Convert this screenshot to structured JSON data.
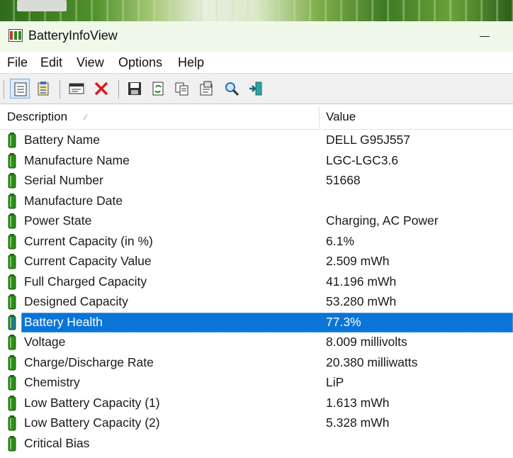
{
  "window": {
    "title": "BatteryInfoView"
  },
  "menu": {
    "items": [
      "File",
      "Edit",
      "View",
      "Options",
      "Help"
    ]
  },
  "toolbar": {
    "buttons": [
      "view-list-icon",
      "view-html-icon",
      "properties-window-icon",
      "delete-icon",
      "save-icon",
      "refresh-icon",
      "copy-icon",
      "properties-icon",
      "find-icon",
      "exit-icon"
    ]
  },
  "table": {
    "columns": [
      "Description",
      "Value"
    ],
    "rows": [
      {
        "desc": "Battery Name",
        "value": "DELL G95J557"
      },
      {
        "desc": "Manufacture Name",
        "value": "LGC-LGC3.6"
      },
      {
        "desc": "Serial Number",
        "value": "51668"
      },
      {
        "desc": "Manufacture Date",
        "value": ""
      },
      {
        "desc": "Power State",
        "value": "Charging, AC Power"
      },
      {
        "desc": "Current Capacity (in %)",
        "value": "6.1%"
      },
      {
        "desc": "Current Capacity Value",
        "value": "2.509 mWh"
      },
      {
        "desc": "Full Charged Capacity",
        "value": "41.196 mWh"
      },
      {
        "desc": "Designed Capacity",
        "value": "53.280 mWh"
      },
      {
        "desc": "Battery Health",
        "value": "77.3%"
      },
      {
        "desc": "Voltage",
        "value": "8.009 millivolts"
      },
      {
        "desc": "Charge/Discharge Rate",
        "value": "20.380 milliwatts"
      },
      {
        "desc": "Chemistry",
        "value": "LiP"
      },
      {
        "desc": "Low Battery Capacity (1)",
        "value": "1.613 mWh"
      },
      {
        "desc": "Low Battery Capacity (2)",
        "value": "5.328 mWh"
      },
      {
        "desc": "Critical Bias",
        "value": ""
      }
    ],
    "selected_index": 9
  },
  "colors": {
    "selection": "#0a74d6",
    "battery_green": "#2e8b1e",
    "titlebar": "#f0f8ea"
  }
}
